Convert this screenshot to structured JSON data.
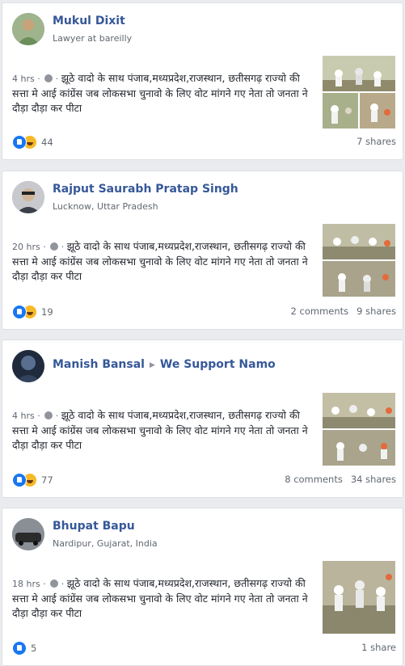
{
  "posts": [
    {
      "name": "Mukul Dixit",
      "target": "",
      "subtitle": "Lawyer at bareilly",
      "time": "4 hrs",
      "text": "झूठे वादो के साथ पंजाब,मध्यप्रदेश,राजस्थान, छतीसगढ़ राज्यो की सत्ता मे आई कांग्रेंस जब लोकसभा चुनावो के लिए वोट मांगने गए नेता तो जनता ने दौड़ा दौड़ा कर पीटा",
      "reactions": "44",
      "comments": "",
      "shares": "7 shares",
      "avatar_colors": [
        "#6b8e5a",
        "#c9a27a"
      ]
    },
    {
      "name": "Rajput Saurabh Pratap Singh",
      "target": "",
      "subtitle": "Lucknow, Uttar Pradesh",
      "time": "20 hrs",
      "text": "झूठे वादो के साथ पंजाब,मध्यप्रदेश,राजस्थान, छतीसगढ़ राज्यो की सत्ता मे आई कांग्रेंस जब लोकसभा चुनावो के लिए वोट मांगने गए नेता तो जनता ने दौड़ा दौड़ा कर पीटा",
      "reactions": "19",
      "comments": "2 comments",
      "shares": "9 shares",
      "avatar_colors": [
        "#3a3f4a",
        "#d1b59a"
      ]
    },
    {
      "name": "Manish Bansal",
      "target": "We Support Namo",
      "subtitle": "",
      "time": "4 hrs",
      "text": "झूठे वादो के साथ पंजाब,मध्यप्रदेश,राजस्थान, छतीसगढ़ राज्यो की सत्ता मे आई कांग्रेंस जब लोकसभा चुनावो के लिए वोट मांगने गए नेता तो जनता ने दौड़ा दौड़ा कर पीटा",
      "reactions": "77",
      "comments": "8 comments",
      "shares": "34 shares",
      "avatar_colors": [
        "#1f2a3c",
        "#5a6f8f"
      ]
    },
    {
      "name": "Bhupat Bapu",
      "target": "",
      "subtitle": "Nardipur, Gujarat, India",
      "time": "18 hrs",
      "text": "झूठे वादो के साथ पंजाब,मध्यप्रदेश,राजस्थान, छतीसगढ़ राज्यो की सत्ता मे आई कांग्रेंस जब लोकसभा चुनावो के लिए वोट मांगने गए नेता तो जनता ने दौड़ा दौड़ा कर पीटा",
      "reactions": "5",
      "comments": "",
      "shares": "1 share",
      "avatar_colors": [
        "#2b2b2b",
        "#8a8f96"
      ]
    }
  ]
}
